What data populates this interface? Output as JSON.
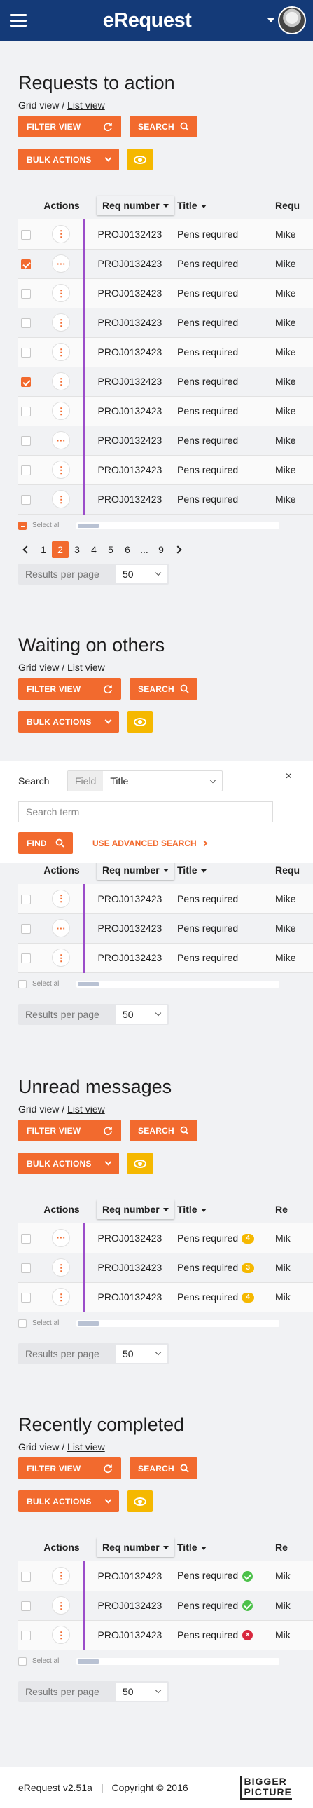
{
  "header": {
    "app_title": "eRequest"
  },
  "common": {
    "grid_view_label": "Grid view",
    "list_view_label": "List view",
    "filter_view_label": "FILTER VIEW",
    "search_label": "SEARCH",
    "bulk_actions_label": "BULK ACTIONS",
    "col_actions": "Actions",
    "col_req": "Req number",
    "col_title": "Title",
    "col_requester": "Requ",
    "select_all": "Select all",
    "results_per_page_label": "Results per page",
    "results_per_page_value": "50"
  },
  "sections": [
    {
      "title": "Requests to action",
      "rows": [
        {
          "checked": false,
          "actions": "⋮",
          "req": "PROJ0132423",
          "title": "Pens required",
          "who": "Mike"
        },
        {
          "checked": true,
          "actions": "···",
          "req": "PROJ0132423",
          "title": "Pens required",
          "who": "Mike"
        },
        {
          "checked": false,
          "actions": "⋮",
          "req": "PROJ0132423",
          "title": "Pens required",
          "who": "Mike"
        },
        {
          "checked": false,
          "actions": "⋮",
          "req": "PROJ0132423",
          "title": "Pens required",
          "who": "Mike"
        },
        {
          "checked": false,
          "actions": "⋮",
          "req": "PROJ0132423",
          "title": "Pens required",
          "who": "Mike"
        },
        {
          "checked": true,
          "actions": "⋮",
          "req": "PROJ0132423",
          "title": "Pens required",
          "who": "Mike"
        },
        {
          "checked": false,
          "actions": "⋮",
          "req": "PROJ0132423",
          "title": "Pens required",
          "who": "Mike"
        },
        {
          "checked": false,
          "actions": "···",
          "req": "PROJ0132423",
          "title": "Pens required",
          "who": "Mike"
        },
        {
          "checked": false,
          "actions": "⋮",
          "req": "PROJ0132423",
          "title": "Pens required",
          "who": "Mike"
        },
        {
          "checked": false,
          "actions": "⋮",
          "req": "PROJ0132423",
          "title": "Pens required",
          "who": "Mike"
        }
      ],
      "pagination": [
        "1",
        "2",
        "3",
        "4",
        "5",
        "6",
        "...",
        "9"
      ],
      "current_page": "2"
    },
    {
      "title": "Waiting on others",
      "rows": [
        {
          "checked": false,
          "actions": "⋮",
          "req": "PROJ0132423",
          "title": "Pens required",
          "who": "Mike"
        },
        {
          "checked": false,
          "actions": "···",
          "req": "PROJ0132423",
          "title": "Pens required",
          "who": "Mike"
        },
        {
          "checked": false,
          "actions": "⋮",
          "req": "PROJ0132423",
          "title": "Pens required",
          "who": "Mike"
        }
      ]
    },
    {
      "title": "Unread messages",
      "col_requester": "Re",
      "rows": [
        {
          "checked": false,
          "actions": "···",
          "req": "PROJ0132423",
          "title": "Pens required",
          "who": "Mik",
          "badge": "4"
        },
        {
          "checked": false,
          "actions": "⋮",
          "req": "PROJ0132423",
          "title": "Pens required",
          "who": "Mik",
          "badge": "3"
        },
        {
          "checked": false,
          "actions": "⋮",
          "req": "PROJ0132423",
          "title": "Pens required",
          "who": "Mik",
          "badge": "4"
        }
      ]
    },
    {
      "title": "Recently completed",
      "col_requester": "Re",
      "rows": [
        {
          "checked": false,
          "actions": "⋮",
          "req": "PROJ0132423",
          "title": "Pens required",
          "who": "Mik",
          "status": "ok"
        },
        {
          "checked": false,
          "actions": "⋮",
          "req": "PROJ0132423",
          "title": "Pens required",
          "who": "Mik",
          "status": "ok"
        },
        {
          "checked": false,
          "actions": "⋮",
          "req": "PROJ0132423",
          "title": "Pens required",
          "who": "Mik",
          "status": "bad"
        }
      ]
    }
  ],
  "search_panel": {
    "search_label": "Search",
    "field_label": "Field",
    "field_value": "Title",
    "term_placeholder": "Search term",
    "find_label": "FIND",
    "advanced_label": "USE ADVANCED SEARCH",
    "close_glyph": "×"
  },
  "footer": {
    "version": "eRequest v2.51a",
    "separator": "|",
    "copyright": "Copyright © 2016",
    "logo_line1": "BIGGER",
    "logo_line2": "PICTURE"
  },
  "colors": {
    "brand": "#143a78",
    "accent": "#f26a2e",
    "warning": "#f5b800",
    "row_marker": "#9b4dc9",
    "success": "#4cc14a",
    "error": "#d8283e"
  },
  "icons": [
    "menu-icon",
    "refresh-icon",
    "search-icon",
    "chevron-down-icon",
    "eye-icon",
    "more-icon",
    "check-icon",
    "error-icon",
    "close-icon",
    "chevron-right-icon"
  ]
}
